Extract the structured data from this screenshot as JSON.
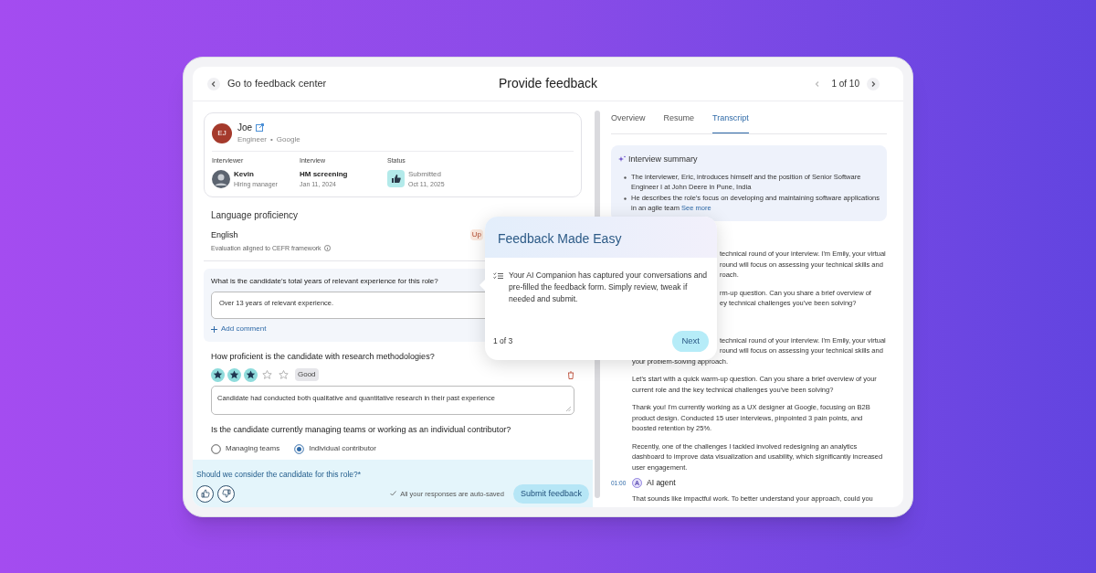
{
  "header": {
    "back_link": "Go to feedback center",
    "title": "Provide feedback",
    "pager": "1 of 10"
  },
  "candidate": {
    "initials": "EJ",
    "name": "Joe",
    "role": "Engineer",
    "separator": "•",
    "company": "Google",
    "details": [
      {
        "kind": "person",
        "label": "Interviewer",
        "title": "Kevin",
        "subtitle": "Hiring manager"
      },
      {
        "kind": "text",
        "label": "Interview",
        "title": "HM screening",
        "subtitle": "Jan 11, 2024"
      },
      {
        "kind": "status",
        "label": "Status",
        "title": "Submitted",
        "subtitle": "Oct 11, 2025"
      }
    ]
  },
  "language": {
    "heading": "Language proficiency",
    "name": "English",
    "note": "Evaluation aligned to CEFR framework",
    "badge": "Up"
  },
  "questions": [
    {
      "kind": "text",
      "question": "What is the candidate's total years of relevant experience for this role?",
      "answer": "Over 13 years of relevant experience.",
      "action": "Add comment"
    },
    {
      "kind": "rating",
      "question": "How proficient is the candidate with research methodologies?",
      "stars": 3,
      "rating_label": "Good",
      "answer": "Candidate had conducted both qualitative and quantitative research in their past experience"
    },
    {
      "kind": "choice",
      "question": "Is the candidate currently managing teams or working as an individual contributor?",
      "options": [
        {
          "label": "Managing teams",
          "selected": false
        },
        {
          "label": "Individual contributor",
          "selected": true
        }
      ]
    }
  ],
  "footer": {
    "question": "Should we consider the candidate for this role?*",
    "saved_note": "All your responses are auto-saved",
    "submit": "Submit feedback"
  },
  "tabs": [
    {
      "label": "Overview",
      "selected": false
    },
    {
      "label": "Resume",
      "selected": false
    },
    {
      "label": "Transcript",
      "selected": true
    }
  ],
  "summary": {
    "title": "Interview summary",
    "bullets": [
      "The interviewer, Eric, introduces himself and the position of Senior Software Engineer I at John Deere in Pune, India",
      "He describes the role's focus on developing and maintaining software applications in an agile team"
    ],
    "link": "See more"
  },
  "transcript": [
    {
      "kind": "partial",
      "lines": [
        "technical round of your interview. I'm Emily, your virtual",
        "round will focus on assessing your technical skills and",
        "roach."
      ]
    },
    {
      "kind": "partial",
      "lines": [
        "rm-up question. Can you share a brief overview of",
        "ey technical challenges you've been solving?"
      ]
    },
    {
      "kind": "partial",
      "lines": [
        "technical round of your interview. I'm Emily, your virtual",
        "round will focus on assessing your technical skills and"
      ],
      "tail": "your problem-solving approach."
    },
    {
      "kind": "text",
      "text": "Let's start with a quick warm-up question. Can you share a brief overview of your current role and the key technical challenges you've been solving?"
    },
    {
      "kind": "text",
      "text": "Thank you! I'm currently working as a UX designer at Google, focusing on B2B product design. Conducted 15 user interviews, pinpointed 3 pain points, and boosted retention by 25%."
    },
    {
      "kind": "text",
      "text": "Recently, one of the challenges I tackled involved redesigning an analytics dashboard to improve data visualization and usability, which significantly increased user engagement."
    },
    {
      "kind": "speaker",
      "time": "01:00",
      "name": "AI agent"
    },
    {
      "kind": "text",
      "text": "That sounds like impactful work. To better understand your approach, could you"
    }
  ],
  "tour": {
    "title": "Feedback Made Easy",
    "body": "Your AI Companion has captured your conversations and pre-filled the feedback form. Simply review, tweak if needed and submit.",
    "step": "1 of 3",
    "next": "Next"
  }
}
